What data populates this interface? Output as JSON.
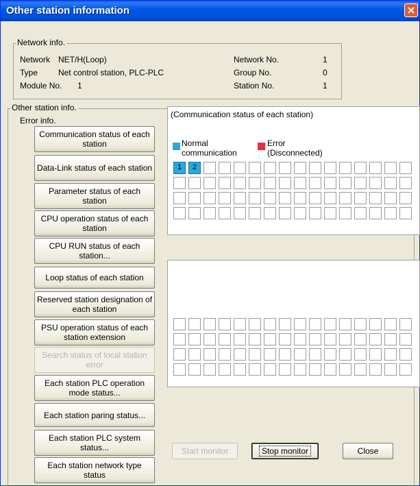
{
  "window": {
    "title": "Other station information"
  },
  "network_info": {
    "legend": "Network info.",
    "rows": [
      {
        "label": "Network",
        "value": "NET/H(Loop)",
        "label2": "Network No.",
        "value2": "1"
      },
      {
        "label": "Type",
        "value": "Net control station, PLC-PLC",
        "label2": "Group No.",
        "value2": "0"
      },
      {
        "label": "Module No.",
        "value": "1",
        "label2": "Station No.",
        "value2": "1"
      }
    ]
  },
  "other_station": {
    "legend": "Other station info.",
    "error_info_label": "Error info.",
    "buttons": [
      {
        "label": "Communication status of each station",
        "enabled": true
      },
      {
        "label": "Data-Link status of each station",
        "enabled": true
      },
      {
        "label": "Parameter status of each station",
        "enabled": true
      },
      {
        "label": "CPU operation status of each station",
        "enabled": true
      },
      {
        "label": "CPU RUN status of each station...",
        "enabled": true
      },
      {
        "label": "Loop status of each station",
        "enabled": true
      },
      {
        "label": "Reserved station designation of each station",
        "enabled": true
      },
      {
        "label": "PSU operation status of each station extension",
        "enabled": true
      },
      {
        "label": "Search status of local station error",
        "enabled": false
      },
      {
        "label": "Each station PLC operation mode status...",
        "enabled": true
      },
      {
        "label": "Each station paring status...",
        "enabled": true
      },
      {
        "label": "Each station PLC system status...",
        "enabled": true
      },
      {
        "label": "Each station network type status",
        "enabled": true
      }
    ]
  },
  "status_panel": {
    "heading": "(Communication status of each station)",
    "legend_normal": "Normal communication",
    "legend_normal_line1": "Normal",
    "legend_normal_line2": "communication",
    "legend_error_line1": "Error",
    "legend_error_line2": "(Disconnected)",
    "normal_color": "#29a8e0",
    "error_color": "#e8303a",
    "grid_top": {
      "rows": 4,
      "cols": 16,
      "normal_stations": [
        "1",
        "2"
      ]
    },
    "grid_bottom": {
      "rows": 4,
      "cols": 16
    }
  },
  "footer": {
    "start_monitor": "Start monitor",
    "stop_monitor": "Stop monitor",
    "close": "Close"
  }
}
